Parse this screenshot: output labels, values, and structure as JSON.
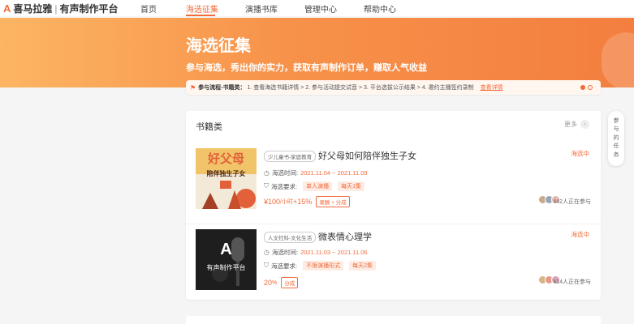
{
  "logo": {
    "brand": "喜马拉雅",
    "platform": "有声制作平台"
  },
  "nav": [
    {
      "label": "首页"
    },
    {
      "label": "海选征集"
    },
    {
      "label": "演播书库"
    },
    {
      "label": "管理中心"
    },
    {
      "label": "帮助中心"
    }
  ],
  "banner": {
    "title": "海选征集",
    "subtitle": "参与海选，秀出你的实力，获取有声制作订单，赚取人气收益"
  },
  "process": {
    "lead": "参与流程-书籍类：",
    "steps": "1. 查看海选书籍详情 > 2. 参与活动提交试音 > 3. 平台选拔公示结果 > 4. 邀约主播签约录制",
    "detail_link": "查看详情"
  },
  "section": {
    "title": "书籍类",
    "more": "更多",
    "more_icon": "›"
  },
  "items": [
    {
      "tag": "少儿童书-家庭教育",
      "title": "好父母如何陪伴独生子女",
      "status": "海选中",
      "time_label": "海选时间:",
      "time_value": "2021.11.04 ~ 2021.11.09",
      "req_label": "海选要求:",
      "req_tags": [
        "单人演播",
        "每天1集"
      ],
      "price": "¥100",
      "price_unit": "/小时",
      "price_extra": "+15%",
      "price_tag": "录酬 + 分成",
      "joined": "442人正在参与",
      "cover_title": "好父母",
      "cover_sub": "陪伴独生子女"
    },
    {
      "tag": "人文社科-文化生活",
      "title": "微表情心理学",
      "status": "海选中",
      "time_label": "海选时间:",
      "time_value": "2021.11.03 ~ 2021.11.06",
      "req_label": "海选要求:",
      "req_tags": [
        "不限演播形式",
        "每天2集"
      ],
      "price": "20",
      "price_unit": "%",
      "price_tag": "分成",
      "joined": "414人正在参与",
      "cover_title": "A",
      "cover_sub": "有声制作平台"
    }
  ],
  "side_float": {
    "label": "参与的任务"
  },
  "colors": {
    "accent": "#f26b3a",
    "banner_start": "#fcb563",
    "banner_end": "#f37e3f"
  }
}
